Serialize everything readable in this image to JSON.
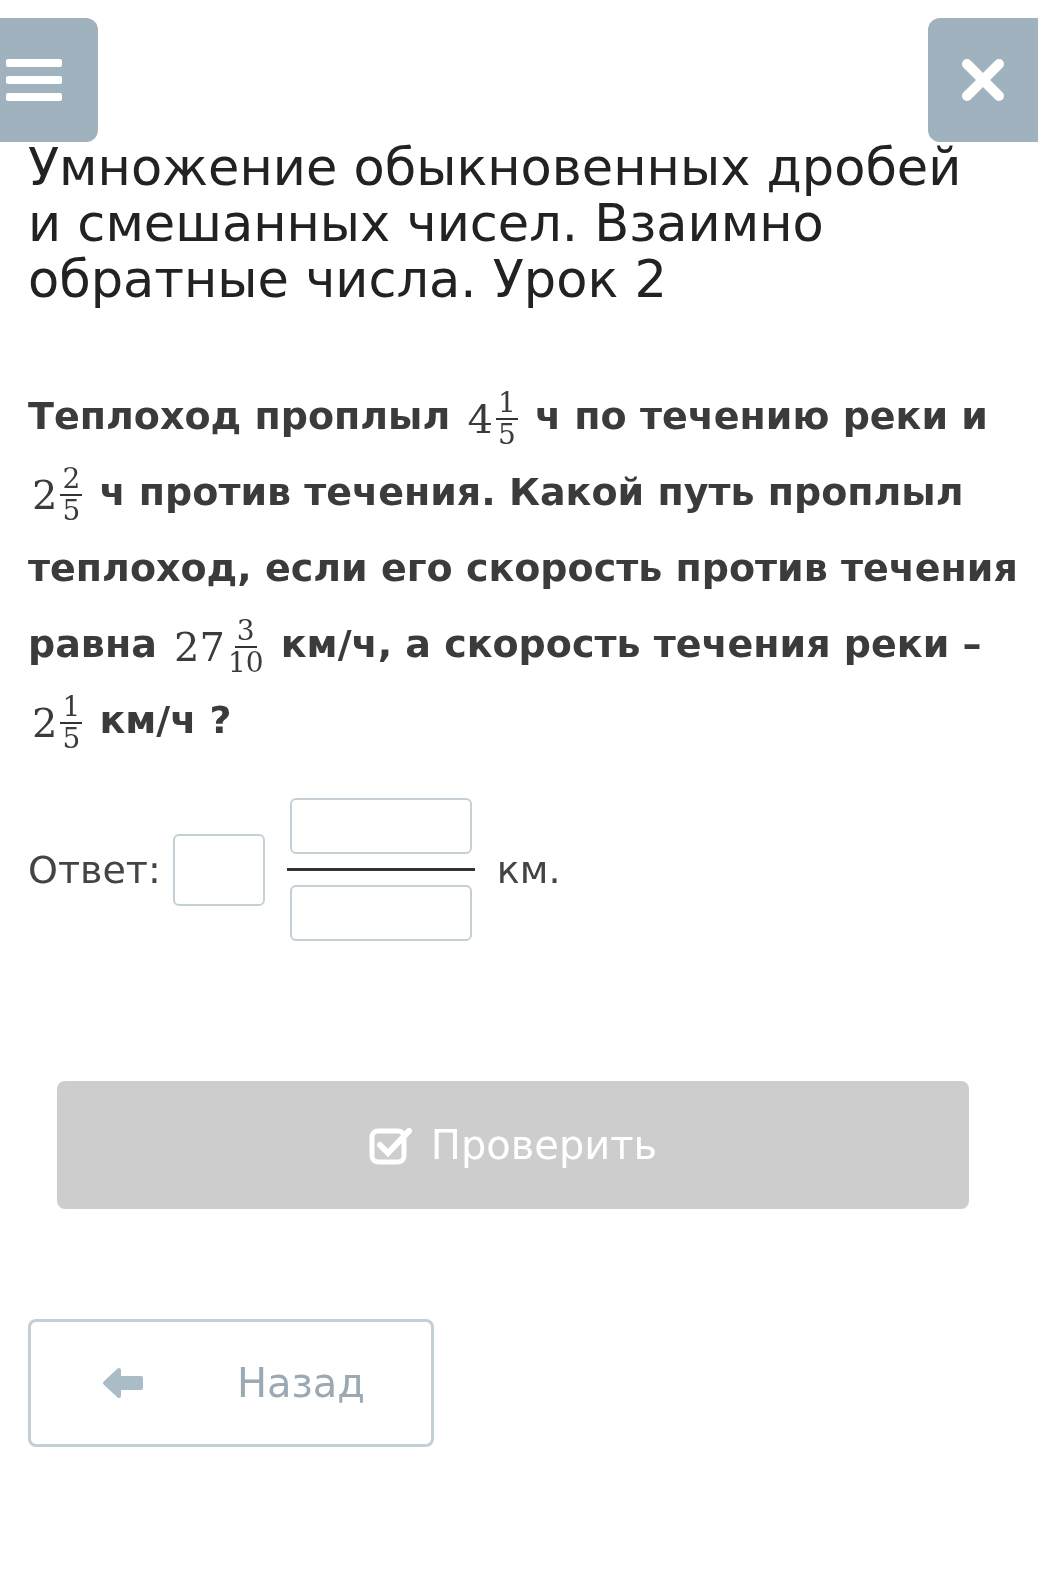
{
  "title": "Умножение обыкновенных дробей и смешанных чисел. Взаимно обратные числа. Урок 2",
  "problem": [
    {
      "kind": "text",
      "text": "Теплоход проплыл "
    },
    {
      "kind": "mixed",
      "whole": "4",
      "num": "1",
      "den": "5"
    },
    {
      "kind": "text",
      "text": " ч по течению реки и "
    },
    {
      "kind": "mixed",
      "whole": "2",
      "num": "2",
      "den": "5"
    },
    {
      "kind": "text",
      "text": " ч против течения. Какой путь проплыл теплоход, если его скорость против течения равна "
    },
    {
      "kind": "mixed",
      "whole": "27",
      "num": "3",
      "den": "10"
    },
    {
      "kind": "text",
      "text": " км/ч, а скорость течения реки – "
    },
    {
      "kind": "mixed",
      "whole": "2",
      "num": "1",
      "den": "5"
    },
    {
      "kind": "text",
      "text": " км/ч ?"
    }
  ],
  "answer": {
    "label": "Ответ:",
    "unit": "км."
  },
  "check_button": {
    "label": "Проверить",
    "disabled": true
  },
  "back_button": {
    "label": "Назад"
  }
}
